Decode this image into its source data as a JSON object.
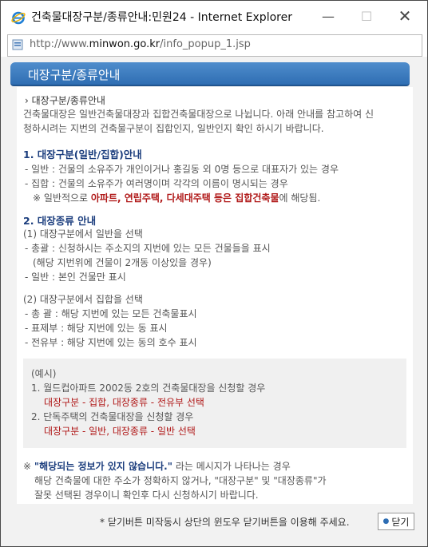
{
  "window": {
    "title": "건축물대장구분/종류안내:민원24 - Internet Explorer",
    "minimize": "—",
    "maximize": "☐",
    "close": "✕"
  },
  "address": {
    "prefix": "http://www.",
    "domain": "minwon.go.kr",
    "path": "/info_popup_1.jsp"
  },
  "header": {
    "title": "대장구분/종류안내"
  },
  "body": {
    "crumb": "› 대장구분/종류안내",
    "intro1": "건축물대장은 일반건축물대장과 집합건축물대장으로 나뉩니다. 아래 안내를 참고하여 신",
    "intro2": "청하시려는 지번의 건축물구분이 집합인지, 일반인지 확인 하시기 바랍니다.",
    "sec1_title": "1. 대장구분(일반/집합)안내",
    "sec1_l1": "- 일반 : 건물의 소유주가 개인이거나 홍길동 외 0명 등으로 대표자가 있는 경우",
    "sec1_l2": "- 집합 : 건물의 소유주가 여러명이며 각각의 이름이 명시되는 경우",
    "sec1_note_pre": "※ 일반적으로 ",
    "sec1_note_red": "아파트, 연립주택, 다세대주택 등은 집합건축물",
    "sec1_note_post": "에 해당됨.",
    "sec2_title": "2. 대장종류 안내",
    "sec2_a": "(1) 대장구분에서 일반을 선택",
    "sec2_a1": "- 총괄 : 신청하시는 주소지의 지번에 있는 모든 건물들을 표시",
    "sec2_a1b": "(해당 지번위에 건물이 2개동 이상있을 경우)",
    "sec2_a2": "- 일반 : 본인 건물만 표시",
    "sec2_b": "(2) 대장구분에서 집합을 선택",
    "sec2_b1": "- 총 괄 : 해당 지번에 있는 모든 건축물표시",
    "sec2_b2": "- 표제부 : 해당 지번에 있는 동 표시",
    "sec2_b3": "- 전유부 : 해당 지번에 있는 동의 호수 표시"
  },
  "example": {
    "label": "(예시)",
    "item1": "1. 월드컵아파트 2002동 2호의 건축물대장을 신청할 경우",
    "item1_sel": "대장구분 - 집합, 대장종류 - 전유부 선택",
    "item2": "2. 단독주택의 건축물대장을 신청할 경우",
    "item2_sel": "대장구분 - 일반, 대장종류 - 일반 선택"
  },
  "notice": {
    "mark": "※ ",
    "quote": "\"해당되는 정보가 있지 않습니다.\"",
    "line1_post": " 라는 메시지가 나타나는 경우",
    "line2": "해당 건축물에 대한 주소가 정확하지 않거나, \"대장구분\" 및 \"대장종류\"가",
    "line3": "잘못 선택된 경우이니 확인후 다시 신청하시기 바랍니다."
  },
  "footer": {
    "note": "* 닫기버튼 미작동시 상단의 윈도우 닫기버튼을 이용해 주세요.",
    "close_label": "닫기"
  }
}
